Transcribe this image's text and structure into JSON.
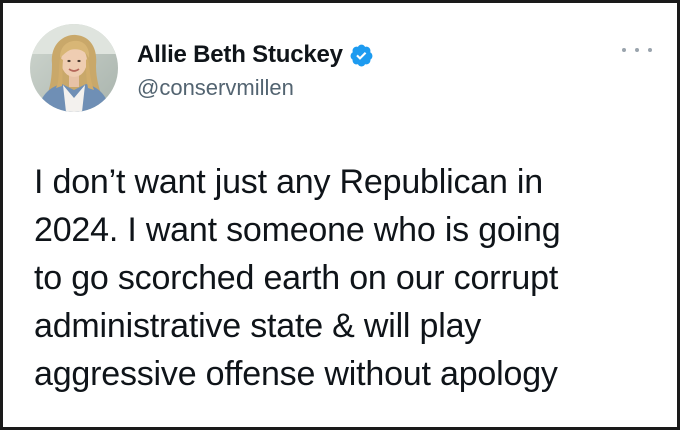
{
  "tweet": {
    "author": {
      "display_name": "Allie Beth Stuckey",
      "handle": "@conservmillen",
      "verified": true,
      "avatar_icon": "profile-photo"
    },
    "more_icon": "more-horizontal-icon",
    "text_lines": [
      "I don’t want just any Republican in",
      "2024. I want someone who is going",
      "to go scorched earth on our corrupt",
      "administrative state & will play",
      "aggressive offense without apology"
    ]
  },
  "colors": {
    "text_primary": "#0f1419",
    "text_secondary": "#536471",
    "verified_blue": "#1d9bf0",
    "frame_border": "#1a1a1a"
  }
}
